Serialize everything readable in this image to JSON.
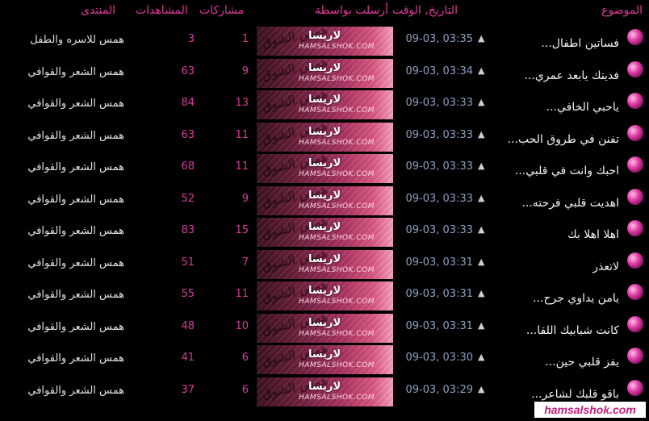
{
  "header": {
    "topic": "الموضوع",
    "datetime": "التاريخ, الوقت",
    "posted_by": "أرسلت بواسطة",
    "posts": "مشاركات",
    "views": "المشاهدات",
    "forum": "المنتدى"
  },
  "banner": {
    "logo_text": "همس الشوق",
    "site_text": "HAMSALSHOK.COM"
  },
  "rows": [
    {
      "topic": "فساتين اطفال...",
      "datetime": "09-03, 03:35",
      "poster": "لاريسا",
      "posts": "1",
      "views": "3",
      "forum": "همس للاسره والطفل"
    },
    {
      "topic": "فديتك يابعد عمري...",
      "datetime": "09-03, 03:34",
      "poster": "لاريسا",
      "posts": "9",
      "views": "63",
      "forum": "همس الشعر والقوافي"
    },
    {
      "topic": "ياحبي الخافي...",
      "datetime": "09-03, 03:33",
      "poster": "لاريسا",
      "posts": "13",
      "views": "84",
      "forum": "همس الشعر والقوافي"
    },
    {
      "topic": "تفنن في طروق الحب...",
      "datetime": "09-03, 03:33",
      "poster": "لاريسا",
      "posts": "11",
      "views": "63",
      "forum": "همس الشعر والقوافي"
    },
    {
      "topic": "احبك وانت في قلبي...",
      "datetime": "09-03, 03:33",
      "poster": "لاريسا",
      "posts": "11",
      "views": "68",
      "forum": "همس الشعر والقوافي"
    },
    {
      "topic": "اهديت قلبي فرحته...",
      "datetime": "09-03, 03:33",
      "poster": "لاريسا",
      "posts": "9",
      "views": "52",
      "forum": "همس الشعر والقوافي"
    },
    {
      "topic": "اهلا اهلا بك",
      "datetime": "09-03, 03:33",
      "poster": "لاريسا",
      "posts": "15",
      "views": "83",
      "forum": "همس الشعر والقوافي"
    },
    {
      "topic": "لاتعذر",
      "datetime": "09-03, 03:31",
      "poster": "لاريسا",
      "posts": "7",
      "views": "51",
      "forum": "همس الشعر والقوافي"
    },
    {
      "topic": "يامن يداوي جرح...",
      "datetime": "09-03, 03:31",
      "poster": "لاريسا",
      "posts": "11",
      "views": "55",
      "forum": "همس الشعر والقوافي"
    },
    {
      "topic": "كانت شبابيك اللقا...",
      "datetime": "09-03, 03:31",
      "poster": "لاريسا",
      "posts": "10",
      "views": "48",
      "forum": "همس الشعر والقوافي"
    },
    {
      "topic": "يفز قلبي حين...",
      "datetime": "09-03, 03:30",
      "poster": "لاريسا",
      "posts": "6",
      "views": "41",
      "forum": "همس الشعر والقوافي"
    },
    {
      "topic": "باقو قلبك لشاعر...",
      "datetime": "09-03, 03:29",
      "poster": "لاريسا",
      "posts": "6",
      "views": "37",
      "forum": "همس الشعر والقوافي"
    }
  ],
  "footer": {
    "site": "hamsalshok.com"
  }
}
